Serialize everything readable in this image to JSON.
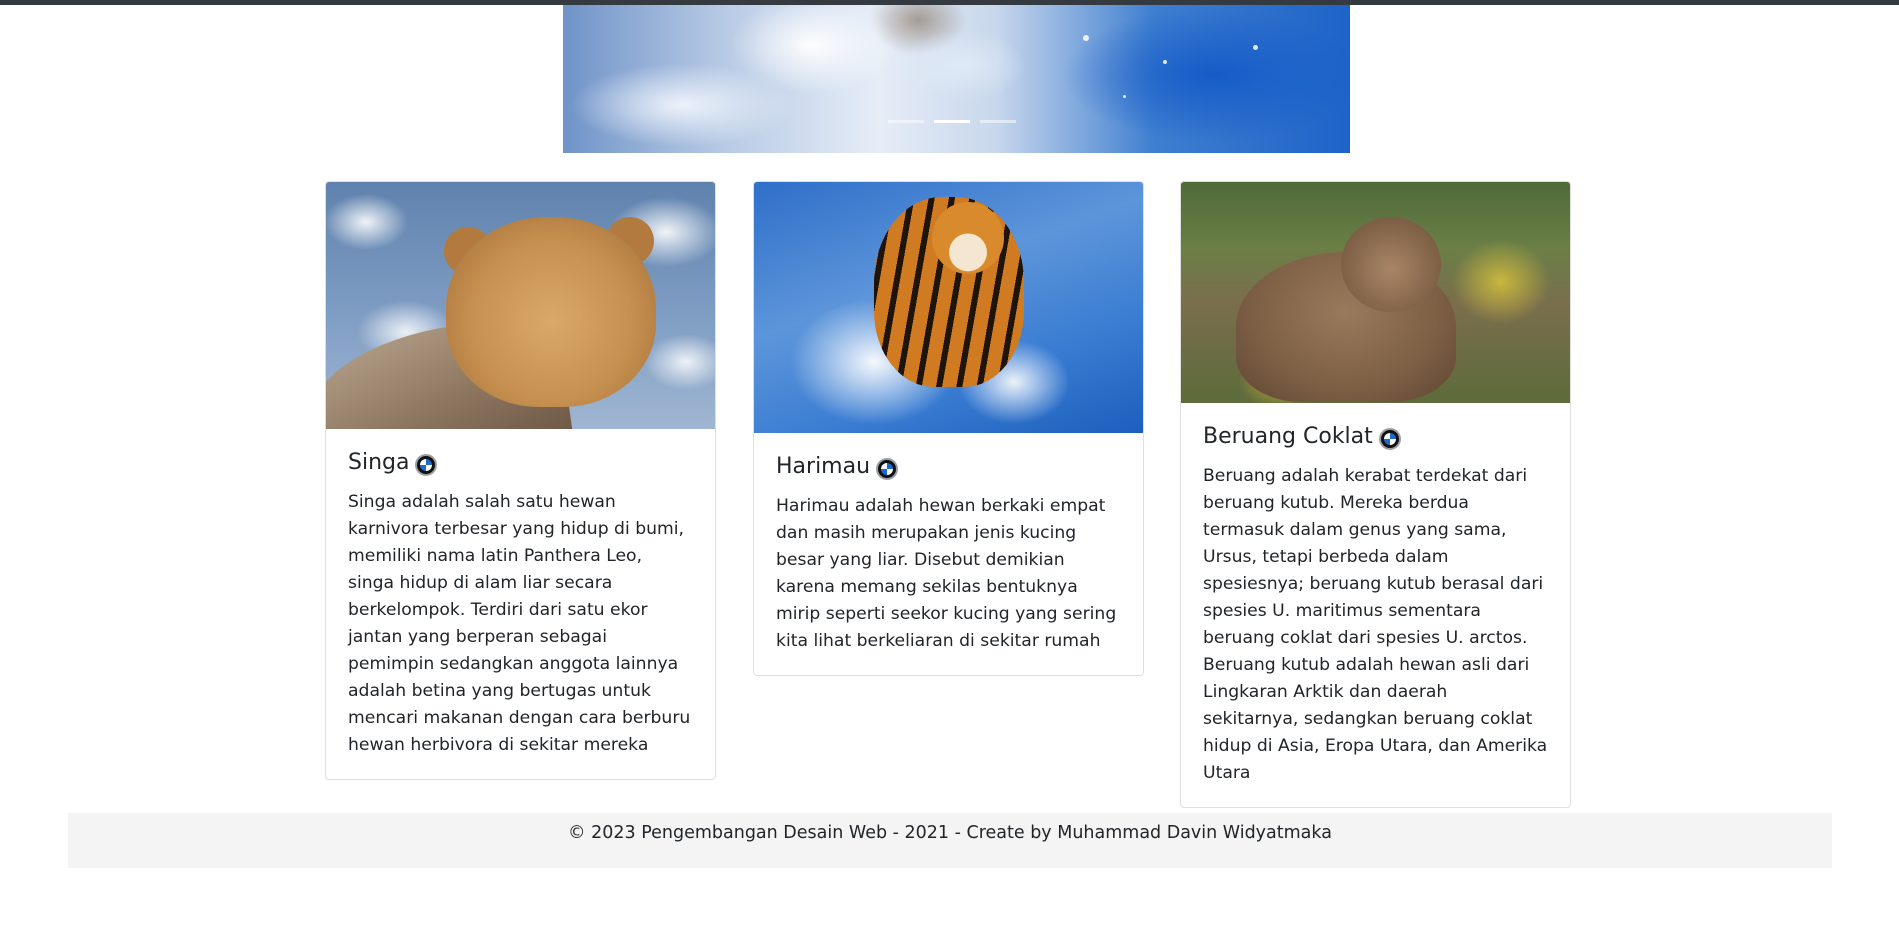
{
  "carousel": {
    "indicators": [
      {
        "label": "Slide 1",
        "active": false
      },
      {
        "label": "Slide 2",
        "active": true
      },
      {
        "label": "Slide 3",
        "active": false
      }
    ]
  },
  "cards": [
    {
      "image_alt": "Singa",
      "title": "Singa",
      "icon": "bmw-logo-icon",
      "text": "Singa adalah salah satu hewan karnivora terbesar yang hidup di bumi, memiliki nama latin Panthera Leo, singa hidup di alam liar secara berkelompok. Terdiri dari satu ekor jantan yang berperan sebagai pemimpin sedangkan anggota lainnya adalah betina yang bertugas untuk mencari makanan dengan cara berburu hewan herbivora di sekitar mereka"
    },
    {
      "image_alt": "Harimau",
      "title": "Harimau",
      "icon": "bmw-logo-icon",
      "text": "Harimau adalah hewan berkaki empat dan masih merupakan jenis kucing besar yang liar. Disebut demikian karena memang sekilas bentuknya mirip seperti seekor kucing yang sering kita lihat berkeliaran di sekitar rumah"
    },
    {
      "image_alt": "Beruang Coklat",
      "title": "Beruang Coklat",
      "icon": "bmw-logo-icon",
      "text": "Beruang adalah kerabat terdekat dari beruang kutub. Mereka berdua termasuk dalam genus yang sama, Ursus, tetapi berbeda dalam spesiesnya; beruang kutub berasal dari spesies U. maritimus sementara beruang coklat dari spesies U. arctos. Beruang kutub adalah hewan asli dari Lingkaran Arktik dan daerah sekitarnya, sedangkan beruang coklat hidup di Asia, Eropa Utara, dan Amerika Utara"
    }
  ],
  "footer": {
    "text": "© 2023 Pengembangan Desain Web - 2021 - Create by Muhammad Davin Widyatmaka"
  },
  "colors": {
    "topbar": "#343a40",
    "footer_bg": "#f4f4f4",
    "text": "#212529",
    "card_border": "rgba(0,0,0,0.125)"
  }
}
